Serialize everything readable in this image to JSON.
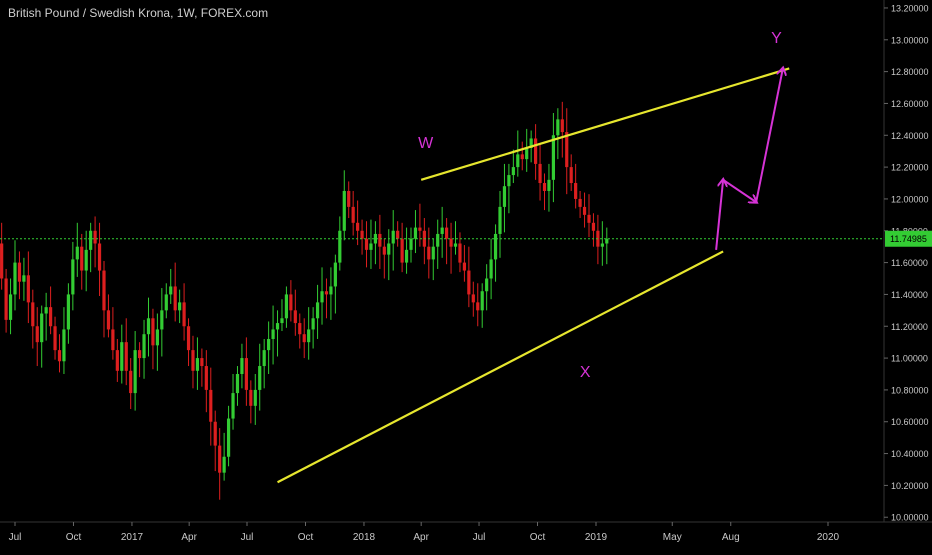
{
  "header": {
    "title": "British Pound / Swedish Krona, 1W, FOREX.com"
  },
  "price_label": "11.74985",
  "colors": {
    "background": "#000000",
    "up": "#33cc33",
    "down": "#dd1f1f",
    "trendline": "#e6e62e",
    "arrow": "#d633d6",
    "wave_label": "#d633d6",
    "price_line": "#33cc33",
    "axis_text": "#c8c8c8"
  },
  "chart_data": {
    "type": "candlestick",
    "title": "British Pound / Swedish Krona, 1W, FOREX.com",
    "ylim": [
      9.97,
      13.25
    ],
    "y_ticks": [
      "13.20000",
      "13.00000",
      "12.80000",
      "12.60000",
      "12.40000",
      "12.20000",
      "12.00000",
      "11.80000",
      "11.60000",
      "11.40000",
      "11.20000",
      "11.00000",
      "10.80000",
      "10.60000",
      "10.40000",
      "10.20000",
      "10.00000"
    ],
    "x_ticks": [
      "Jul",
      "Oct",
      "2017",
      "Apr",
      "Jul",
      "Oct",
      "2018",
      "Apr",
      "Jul",
      "Oct",
      "2019",
      "May",
      "Aug",
      "2020"
    ],
    "x_tick_dates": [
      "2016-07-01",
      "2016-10-01",
      "2017-01-01",
      "2017-04-01",
      "2017-07-01",
      "2017-10-01",
      "2018-01-01",
      "2018-04-01",
      "2018-07-01",
      "2018-10-01",
      "2019-01-01",
      "2019-05-01",
      "2019-08-01",
      "2020-01-01"
    ],
    "current_price": 11.74985,
    "closes": [
      12.1,
      11.72,
      11.5,
      11.24,
      11.4,
      11.6,
      11.48,
      11.52,
      11.35,
      11.2,
      11.1,
      11.28,
      11.32,
      11.2,
      11.05,
      10.98,
      11.18,
      11.4,
      11.62,
      11.7,
      11.55,
      11.68,
      11.8,
      11.72,
      11.55,
      11.3,
      11.18,
      11.05,
      10.92,
      11.1,
      10.92,
      10.78,
      11.05,
      11.0,
      11.15,
      11.25,
      11.08,
      11.18,
      11.3,
      11.4,
      11.45,
      11.3,
      11.35,
      11.2,
      11.05,
      10.92,
      11.0,
      10.95,
      10.8,
      10.6,
      10.45,
      10.28,
      10.38,
      10.62,
      10.78,
      10.9,
      11.0,
      10.8,
      10.7,
      10.8,
      10.95,
      11.05,
      11.12,
      11.18,
      11.22,
      11.25,
      11.4,
      11.3,
      11.22,
      11.15,
      11.1,
      11.18,
      11.25,
      11.35,
      11.42,
      11.4,
      11.45,
      11.6,
      11.8,
      12.05,
      11.95,
      11.85,
      11.8,
      11.75,
      11.68,
      11.72,
      11.78,
      11.7,
      11.65,
      11.72,
      11.8,
      11.75,
      11.6,
      11.68,
      11.75,
      11.82,
      11.8,
      11.7,
      11.62,
      11.7,
      11.78,
      11.82,
      11.75,
      11.7,
      11.72,
      11.6,
      11.55,
      11.4,
      11.35,
      11.3,
      11.42,
      11.5,
      11.62,
      11.78,
      11.95,
      12.08,
      12.15,
      12.2,
      12.28,
      12.25,
      12.32,
      12.38,
      12.22,
      12.1,
      12.05,
      12.12,
      12.4,
      12.5,
      12.42,
      12.2,
      12.1,
      12.0,
      11.95,
      11.9,
      11.85,
      11.8,
      11.7,
      11.72,
      11.75
    ],
    "trendlines": [
      {
        "from": {
          "date": "2018-04-01",
          "value": 12.12
        },
        "to": {
          "date": "2019-11-01",
          "value": 12.82
        }
      },
      {
        "from": {
          "date": "2017-08-18",
          "value": 10.22
        },
        "to": {
          "date": "2019-07-20",
          "value": 11.67
        }
      }
    ],
    "projection_path": [
      {
        "date": "2019-07-09",
        "value": 11.68
      },
      {
        "date": "2019-07-20",
        "value": 12.12
      },
      {
        "date": "2019-09-10",
        "value": 11.98
      },
      {
        "date": "2019-10-22",
        "value": 12.82
      }
    ],
    "annotations": [
      {
        "text": "W",
        "date": "2018-04-08",
        "value": 12.32
      },
      {
        "text": "X",
        "date": "2018-12-15",
        "value": 10.88
      },
      {
        "text": "Y",
        "date": "2019-10-12",
        "value": 12.98
      }
    ]
  }
}
